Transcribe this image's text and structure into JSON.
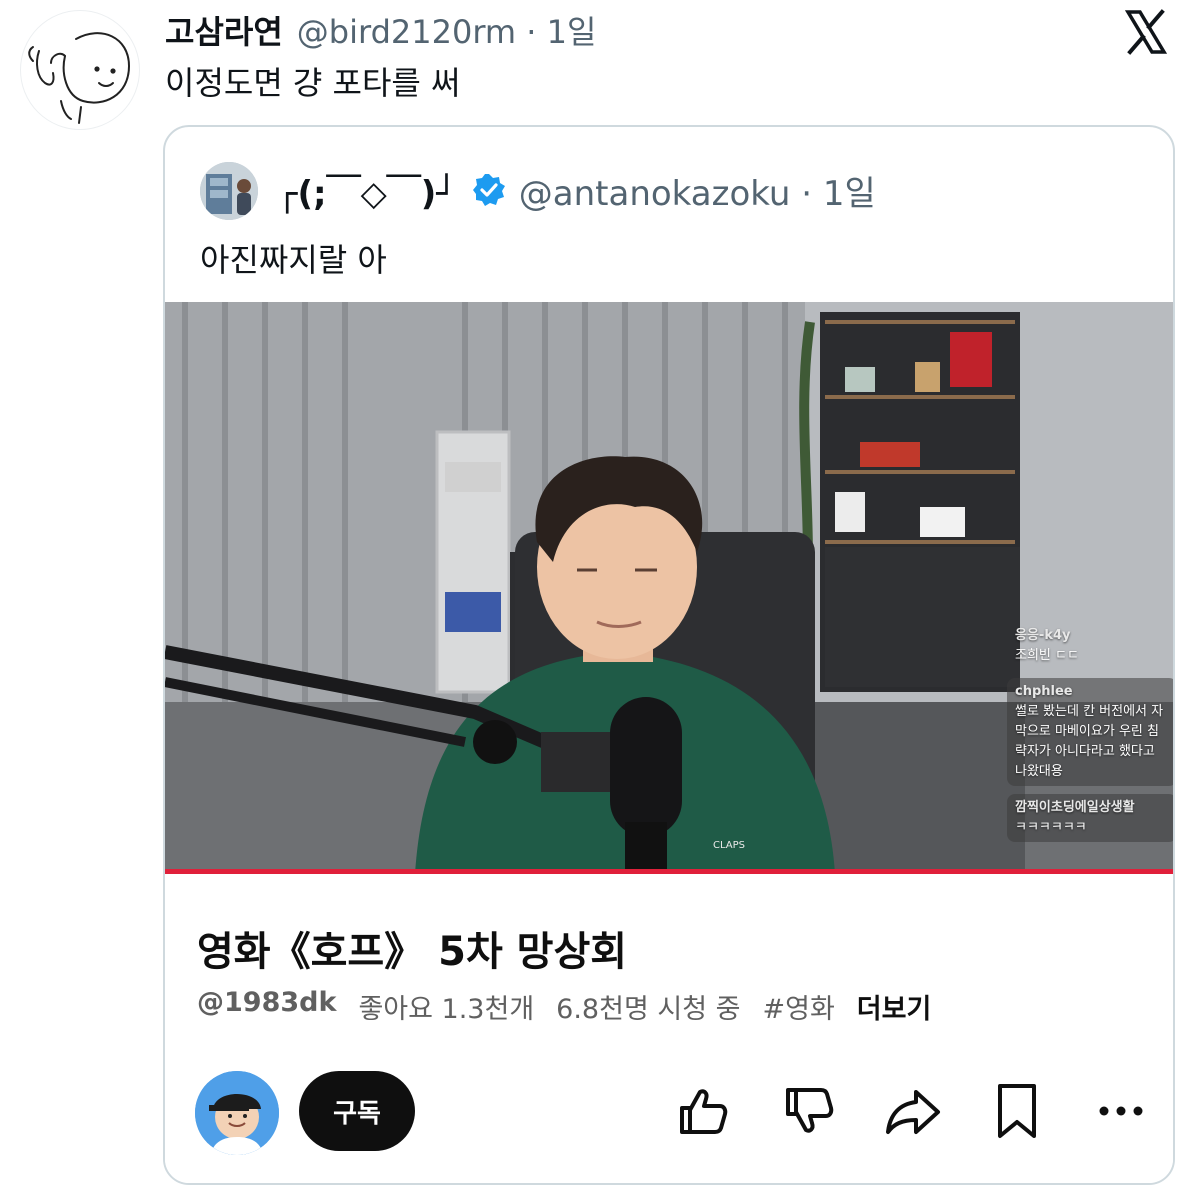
{
  "tweet": {
    "display_name": "고삼라연",
    "handle_time": "@bird2120rm · 1일",
    "text": "이정도면 걍 포타를 써",
    "logo": "x-logo-icon"
  },
  "quoted_tweet": {
    "display_name": "┌(;￣◇￣)┘",
    "verified_badge": "verified-icon",
    "handle_time": "@antanokazoku · 1일",
    "text": "아진짜지랄 아"
  },
  "video_chat": [
    {
      "user": "응응-k4y",
      "text": "조희빈 ㄷㄷ"
    },
    {
      "user": "chphlee",
      "text": "썰로 봤는데 칸 버전에서 자막으로 마베이요가 우린 침략자가 아니다라고 했다고 나왔대용"
    },
    {
      "user": "깜찍이초딩에일상생활",
      "text": "ㅋㅋㅋㅋㅋㅋ"
    }
  ],
  "youtube": {
    "title": "영화《호프》 5차 망상회",
    "channel": "@1983dk",
    "likes": "좋아요 1.3천개",
    "viewers": "6.8천명 시청 중",
    "hashtag": "#영화",
    "more_label": "더보기",
    "subscribe_label": "구독",
    "actions": [
      "thumbs-up-icon",
      "thumbs-down-icon",
      "share-icon",
      "save-icon",
      "more-icon"
    ],
    "accent_color": "#e0203a"
  }
}
